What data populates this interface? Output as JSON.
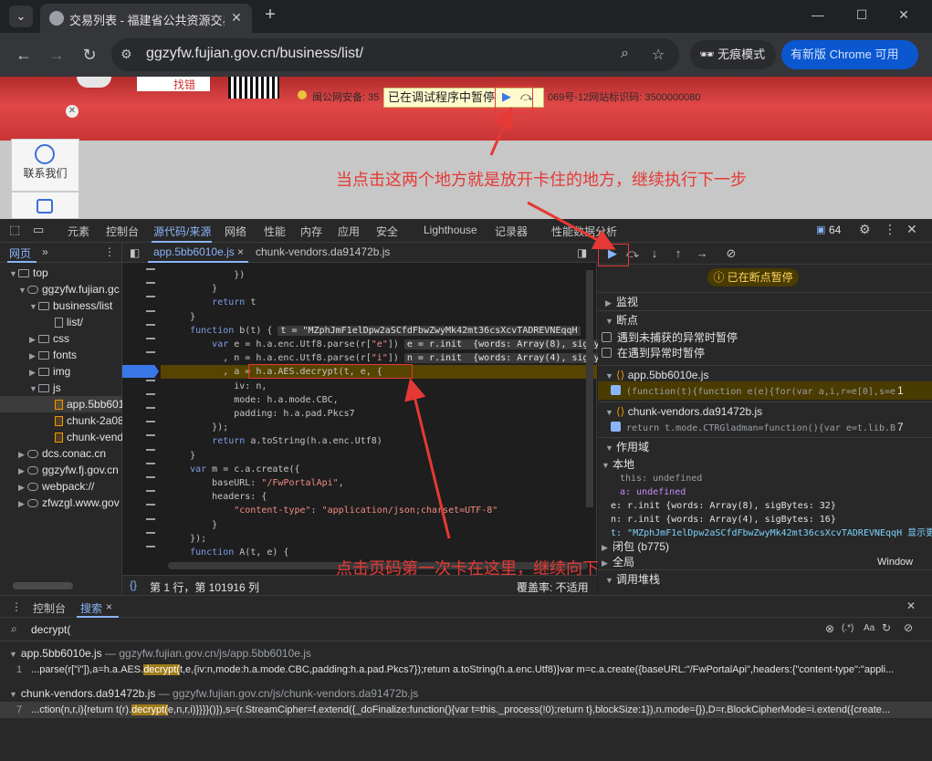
{
  "browser": {
    "tab_title": "交易列表 - 福建省公共资源交易",
    "url": "ggzyfw.fujian.gov.cn/business/list/",
    "incognito_label": "无痕模式",
    "chrome_update_label": "有新版 Chrome 可用"
  },
  "page": {
    "paused_label": "已在调试程序中暂停",
    "footer_text_1": "闽公网安备: 35",
    "footer_text_2": "069号-12网站标识码: 3500000080",
    "sidebar_contact": "联系我们",
    "badge_text": "找错",
    "annotation_top": "当点击这两个地方就是放开卡住的地方，继续执行下一步",
    "annotation_bottom": "点击页码第一次卡在这里，继续向下执行还会在卡住一处"
  },
  "devtools": {
    "tabs": [
      "元素",
      "控制台",
      "源代码/来源",
      "网络",
      "性能",
      "内存",
      "应用",
      "安全",
      "Lighthouse",
      "记录器",
      "性能数据分析"
    ],
    "issues_count": "64",
    "navigator_tab": "网页",
    "tree": [
      {
        "label": "top",
        "level": 0
      },
      {
        "label": "ggzyfw.fujian.gc",
        "level": 1
      },
      {
        "label": "business/list",
        "level": 2
      },
      {
        "label": "list/",
        "level": 3
      },
      {
        "label": "css",
        "level": 2
      },
      {
        "label": "fonts",
        "level": 2
      },
      {
        "label": "img",
        "level": 2
      },
      {
        "label": "js",
        "level": 2
      },
      {
        "label": "app.5bb601",
        "level": 3
      },
      {
        "label": "chunk-2a08",
        "level": 3
      },
      {
        "label": "chunk-vend",
        "level": 3
      },
      {
        "label": "dcs.conac.cn",
        "level": 1
      },
      {
        "label": "ggzyfw.fj.gov.cn",
        "level": 1
      },
      {
        "label": "webpack://",
        "level": 1
      },
      {
        "label": "zfwzgl.www.gov",
        "level": 1
      }
    ],
    "editor_tabs": [
      "app.5bb6010e.js",
      "chunk-vendors.da91472b.js"
    ],
    "status_position": "第 1 行，第 101916 列",
    "status_coverage": "覆盖率: 不适用",
    "paused_pill": "已在断点暂停",
    "sections": {
      "watch": "监视",
      "breakpoints": "断点",
      "pause_uncaught": "遇到未捕获的异常时暂停",
      "pause_caught": "在遇到异常时暂停",
      "bp_file1": "app.5bb6010e.js",
      "bp_code1": "(function(t){function e(e){for(var a,i,r=e[0],s=e",
      "bp_line1": "1",
      "bp_file2": "chunk-vendors.da91472b.js",
      "bp_code2": "return t.mode.CTRGladman=function(){var e=t.lib.B",
      "bp_line2": "7",
      "scope": "作用域",
      "local": "本地",
      "closure": "闭包 (b775)",
      "global": "全局",
      "global_val": "Window",
      "callstack": "调用堆栈"
    },
    "scope_lines": [
      "this: undefined",
      "a: undefined",
      "e: r.init  {words: Array(8), sigBytes: 32}",
      "n: r.init  {words: Array(4), sigBytes: 16}",
      "t: \"MZphJmF1elDpw2aSCfdFbwZwyMk42mt36csXcvTADREVNEqqH 显示更"
    ],
    "code": [
      "            })",
      "        }",
      "        return t",
      "    }",
      "    function b(t) {",
      "        var e = h.a.enc.Utf8.parse(r[\"e\"])",
      "          , n = h.a.enc.Utf8.parse(r[\"i\"])",
      "          , a = h.a.AES.decrypt(t, e, {",
      "            iv: n,",
      "            mode: h.a.mode.CBC,",
      "            padding: h.a.pad.Pkcs7",
      "        });",
      "        return a.toString(h.a.enc.Utf8)",
      "    }",
      "    var m = c.a.create({",
      "        baseURL: \"/FwPortalApi\",",
      "        headers: {",
      "            \"content-type\": \"application/json;charset=UTF-8\"",
      "        }",
      "    });",
      "    function A(t, e) {"
    ],
    "inline_vals": {
      "t": "t = \"MZphJmF1elDpw2aSCfdFbwZwyMk42mt36csXcvTADREVNEqqH",
      "e": "e = r.init  {words: Array(8), sigBy",
      "n": "n = r.init  {words: Array(4), sigBy"
    },
    "drawer_tabs": [
      "控制台",
      "搜索"
    ],
    "search_query": "decrypt(",
    "results": [
      {
        "file": "app.5bb6010e.js",
        "path": "ggzyfw.fujian.gov.cn/js/app.5bb6010e.js",
        "line_no": "1",
        "pre": "...parse(r[\"i\"]),a=h.a.AES.",
        "match": "decrypt(",
        "post": "t,e,{iv:n,mode:h.a.mode.CBC,padding:h.a.pad.Pkcs7});return a.toString(h.a.enc.Utf8)}var m=c.a.create({baseURL:\"/FwPortalApi\",headers:{\"content-type\":\"appli..."
      },
      {
        "file": "chunk-vendors.da91472b.js",
        "path": "ggzyfw.fujian.gov.cn/js/chunk-vendors.da91472b.js",
        "line_no": "7",
        "pre": "...ction(n,r,i){return t(r).",
        "match": "decrypt(",
        "post": "e,n,r,i)}}}}()}),s=(r.StreamCipher=f.extend({_doFinalize:function(){var t=this._process(!0);return t},blockSize:1}),n.mode={}),D=r.BlockCipherMode=i.extend({create..."
      }
    ]
  }
}
